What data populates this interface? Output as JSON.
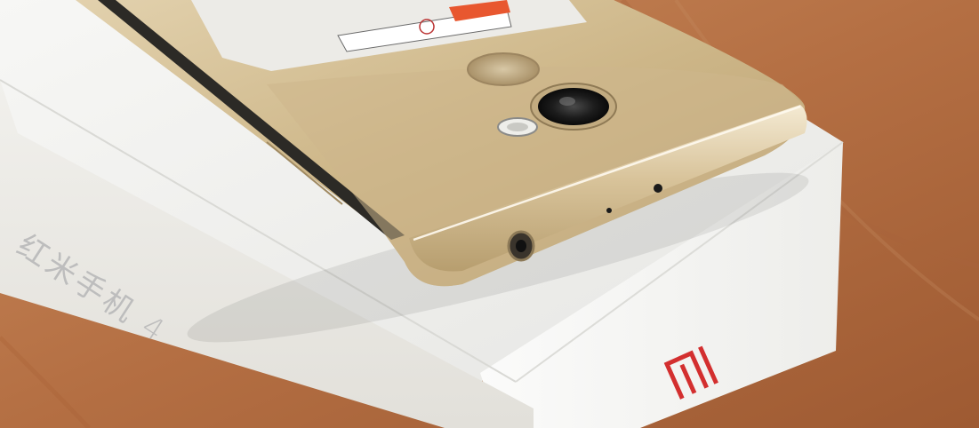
{
  "box": {
    "side_text": "红米手机 4",
    "brand_logo": "mi-logo",
    "logo_color": "#d32f2f"
  },
  "phone": {
    "color": "#d9c49a",
    "label_icon": "warning-icon"
  },
  "colors": {
    "table": "#b9774c",
    "box_white": "#f3f3f1",
    "phone_gold": "#d9c49a"
  }
}
